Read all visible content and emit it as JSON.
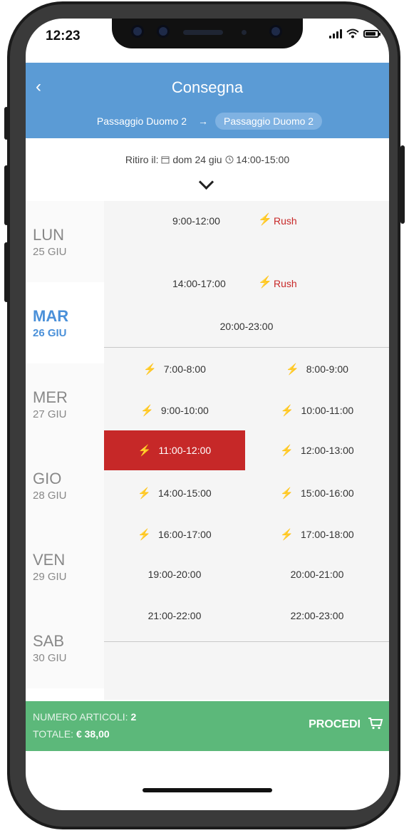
{
  "status": {
    "time": "12:23"
  },
  "header": {
    "back_icon": "‹",
    "title": "Consegna",
    "from": "Passaggio Duomo 2",
    "arrow": "→",
    "to": "Passaggio Duomo 2"
  },
  "pickup": {
    "label": "Ritiro il:",
    "date": "dom 24 giu",
    "time": "14:00-15:00"
  },
  "days": [
    {
      "name": "LUN",
      "date": "25 GIU",
      "selected": false
    },
    {
      "name": "MAR",
      "date": "26 GIU",
      "selected": true
    },
    {
      "name": "MER",
      "date": "27 GIU",
      "selected": false
    },
    {
      "name": "GIO",
      "date": "28 GIU",
      "selected": false
    },
    {
      "name": "VEN",
      "date": "29 GIU",
      "selected": false
    },
    {
      "name": "SAB",
      "date": "30 GIU",
      "selected": false
    }
  ],
  "slots": {
    "rush_label": "Rush",
    "top": [
      {
        "time": "9:00-12:00",
        "rush": true
      },
      {
        "time": "14:00-17:00",
        "rush": true
      },
      {
        "time": "20:00-23:00",
        "rush": false
      }
    ],
    "grid": [
      {
        "time": "7:00-8:00",
        "bolt": true,
        "selected": false
      },
      {
        "time": "8:00-9:00",
        "bolt": true,
        "selected": false
      },
      {
        "time": "9:00-10:00",
        "bolt": true,
        "selected": false
      },
      {
        "time": "10:00-11:00",
        "bolt": true,
        "selected": false
      },
      {
        "time": "11:00-12:00",
        "bolt": true,
        "selected": true
      },
      {
        "time": "12:00-13:00",
        "bolt": true,
        "selected": false
      },
      {
        "time": "14:00-15:00",
        "bolt": true,
        "selected": false
      },
      {
        "time": "15:00-16:00",
        "bolt": true,
        "selected": false
      },
      {
        "time": "16:00-17:00",
        "bolt": true,
        "selected": false
      },
      {
        "time": "17:00-18:00",
        "bolt": true,
        "selected": false
      },
      {
        "time": "19:00-20:00",
        "bolt": false,
        "selected": false
      },
      {
        "time": "20:00-21:00",
        "bolt": false,
        "selected": false
      },
      {
        "time": "21:00-22:00",
        "bolt": false,
        "selected": false
      },
      {
        "time": "22:00-23:00",
        "bolt": false,
        "selected": false
      }
    ]
  },
  "footer": {
    "items_label": "NUMERO ARTICOLI:",
    "items_count": "2",
    "total_label": "TOTALE:",
    "total_value": "€ 38,00",
    "proceed_label": "PROCEDI"
  },
  "colors": {
    "header": "#5b9bd5",
    "selected_day": "#4a90d9",
    "rush": "#c82828",
    "selected_slot": "#c62828",
    "footer": "#5cb87a"
  },
  "icons": {
    "back": "chevron-left-icon",
    "arrow": "arrow-right-icon",
    "calendar": "calendar-icon",
    "clock": "clock-icon",
    "expand": "chevron-down-icon",
    "bolt": "lightning-bolt-icon",
    "cart": "cart-icon"
  }
}
